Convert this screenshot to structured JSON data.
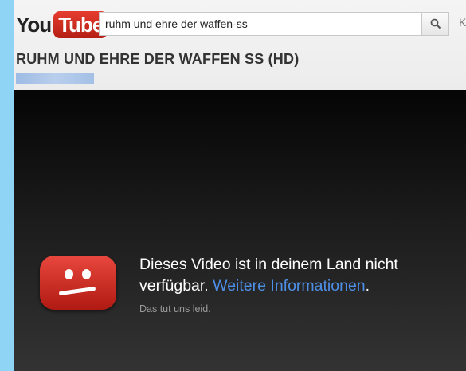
{
  "logo": {
    "part1": "You",
    "part2": "Tube"
  },
  "search": {
    "query": "ruhm und ehre der waffen-ss",
    "button_icon": "search-icon"
  },
  "header_extra": "K",
  "video": {
    "title": "RUHM UND EHRE DER WAFFEN SS (HD)"
  },
  "player": {
    "icon": "sad-face-icon",
    "message_part1": "Dieses Video ist in deinem Land nicht verfügbar.",
    "link_text": "Weitere Informationen",
    "message_end": ".",
    "sub_text": "Das tut uns leid."
  },
  "colors": {
    "background": "#8fd3f5",
    "brand_red": "#e62117",
    "link": "#4d8fe7"
  }
}
